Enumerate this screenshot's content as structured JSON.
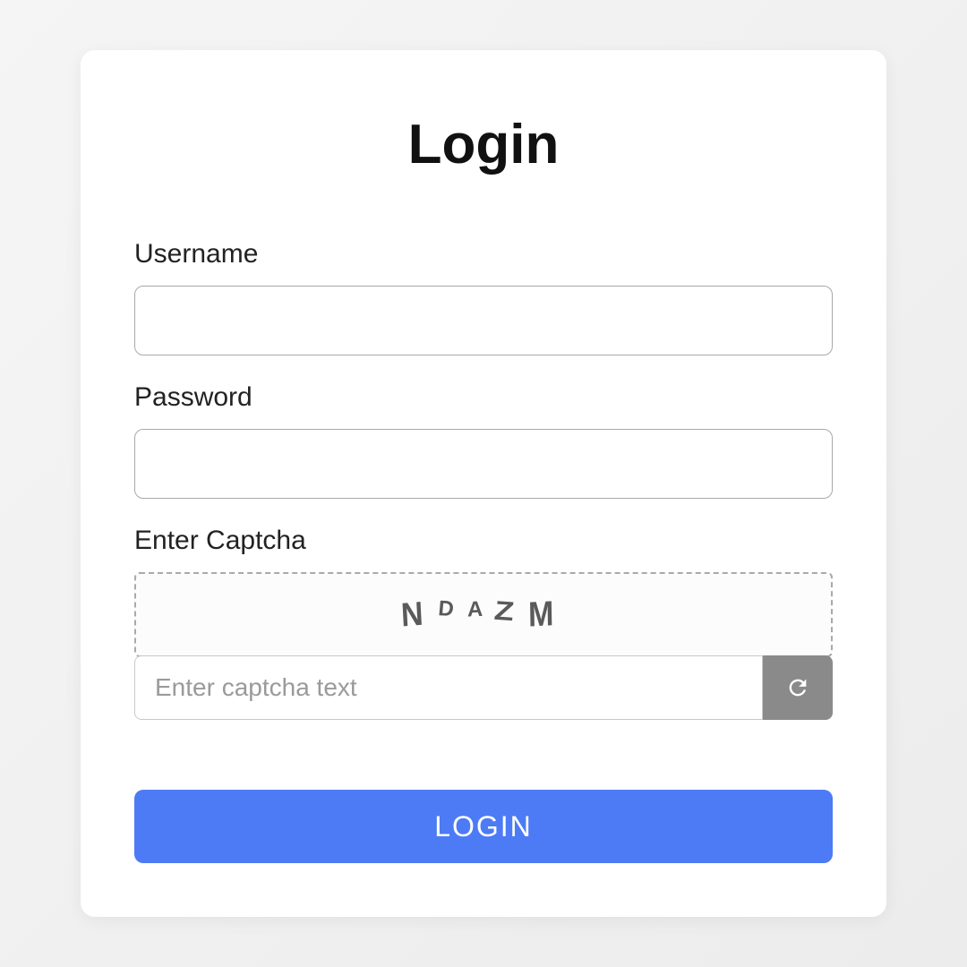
{
  "form": {
    "title": "Login",
    "username": {
      "label": "Username",
      "value": ""
    },
    "password": {
      "label": "Password",
      "value": ""
    },
    "captcha": {
      "label": "Enter Captcha",
      "chars": [
        "N",
        "D",
        "A",
        "Z",
        "M"
      ],
      "input_placeholder": "Enter captcha text",
      "input_value": ""
    },
    "submit_label": "LOGIN"
  }
}
